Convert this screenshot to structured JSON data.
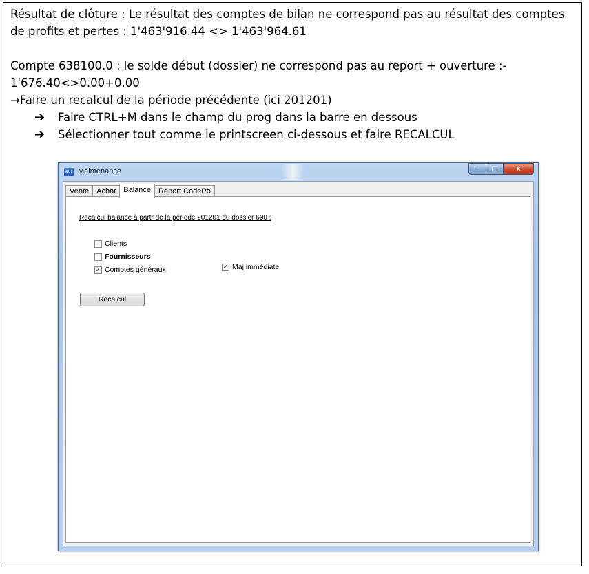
{
  "doc": {
    "line1": "Résultat de clôture : Le résultat des comptes de bilan ne correspond pas au résultat des comptes",
    "line2": "de profits et pertes : 1'463'916.44 <> 1'463'964.61",
    "line3": "Compte 638100.0 : le solde début (dossier) ne correspond pas au report + ouverture :-",
    "line4": "1'676.40<>0.00+0.00",
    "arrow_glyph": "→",
    "line5": "Faire un recalcul de la période précédente (ici 201201)",
    "bullet_glyph": "➔",
    "bullet1": "Faire CTRL+M dans le champ du prog dans la barre en dessous",
    "bullet2": "Sélectionner tout comme le printscreen ci-dessous et faire RECALCUL"
  },
  "window": {
    "icon_text": "aur",
    "title": "Maintenance",
    "buttons": {
      "minimize": "–",
      "maximize": "□",
      "close": "x"
    }
  },
  "tabs": [
    {
      "label": "Vente",
      "active": false
    },
    {
      "label": "Achat",
      "active": false
    },
    {
      "label": "Balance",
      "active": true
    },
    {
      "label": "Report CodePo",
      "active": false
    }
  ],
  "balance": {
    "heading": "Recalcul balance à partr de la période 201201 du dossier 690 :",
    "checkboxes": {
      "clients": {
        "label": "Clients",
        "checked": false
      },
      "fournisseurs": {
        "label": "Fournisseurs",
        "checked": false
      },
      "comptes": {
        "label": "Comptes généraux",
        "checked": true
      },
      "maj": {
        "label": "Maj immédiate",
        "checked": true
      }
    },
    "check_glyph": "✓",
    "recalcul_button": "Recalcul"
  }
}
